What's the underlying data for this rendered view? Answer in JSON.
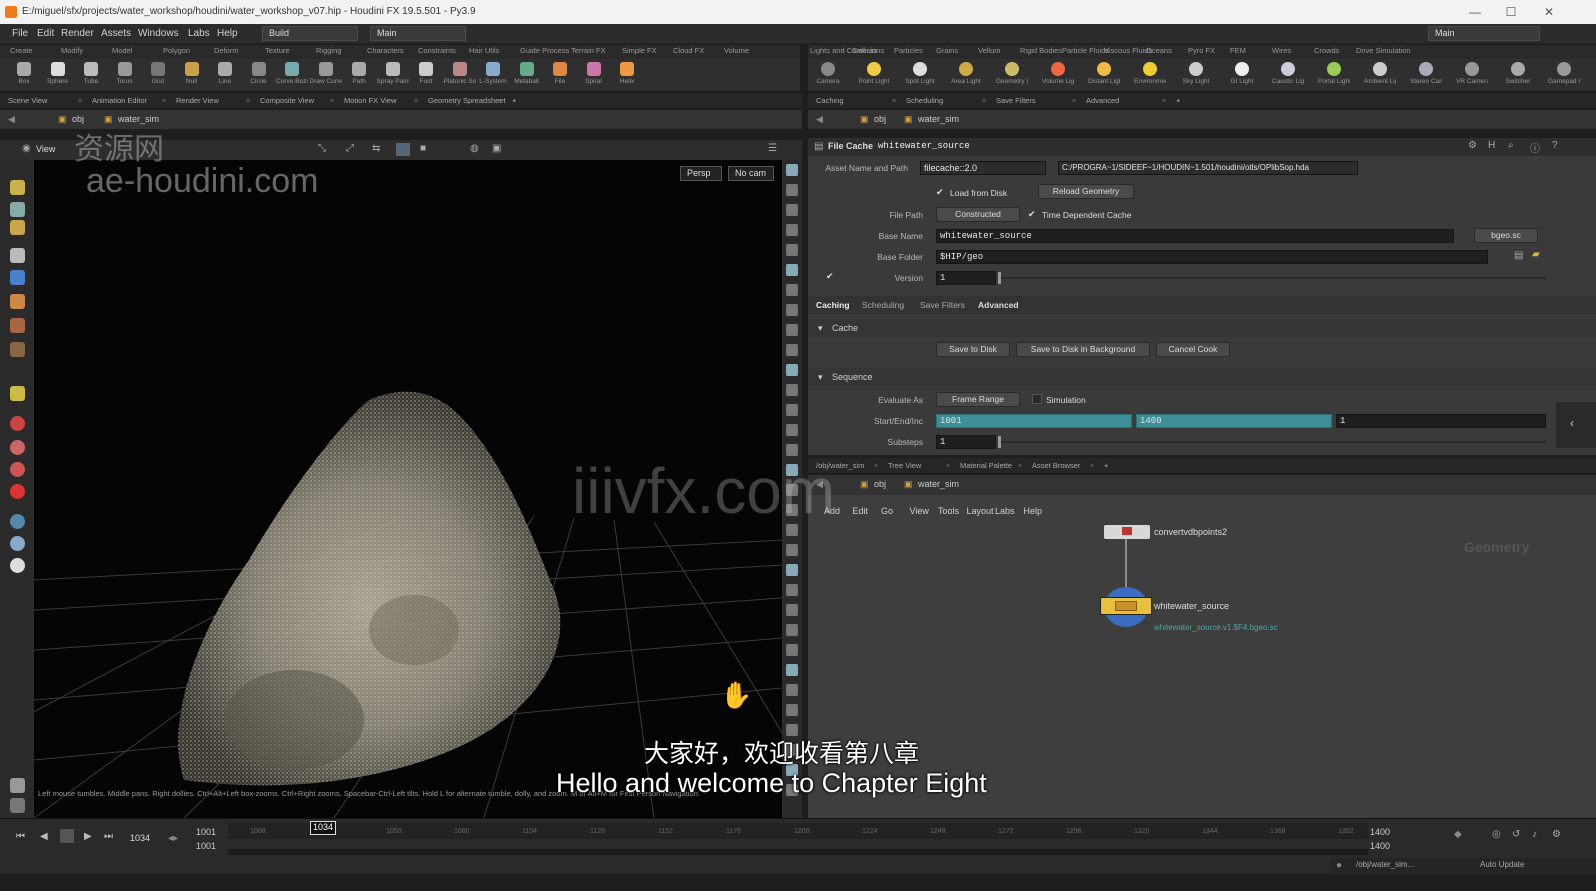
{
  "window": {
    "title": "E:/miguel/sfx/projects/water_workshop/houdini/water_workshop_v07.hip - Houdini FX 19.5.501 - Py3.9",
    "minimize": "—",
    "maximize": "☐",
    "close": "✕"
  },
  "menubar": {
    "items": [
      "File",
      "Edit",
      "Render",
      "Assets",
      "Windows",
      "Labs",
      "Help"
    ],
    "desktop": "Build",
    "runtime": "Main",
    "right_desktop": "Main"
  },
  "shelf_left": {
    "tabs": [
      "Create",
      "Modify",
      "Model",
      "Polygon",
      "Deform",
      "Texture",
      "Rigging",
      "Characters",
      "Constraints",
      "Hair Utils",
      "Guide Process",
      "Terrain FX",
      "Simple FX",
      "Cloud FX",
      "Volume"
    ],
    "tools": [
      "Box",
      "Sphere",
      "Tube",
      "Torus",
      "Grid",
      "Null",
      "Line",
      "Circle",
      "Curve Bezier",
      "Draw Curve",
      "Path",
      "Spray Paint",
      "Font",
      "Platonic Solids",
      "L-System",
      "Metaball",
      "File",
      "Spiral",
      "Helix"
    ]
  },
  "shelf_right": {
    "tabs": [
      "Lights and Cameras",
      "Collisions",
      "Particles",
      "Grains",
      "Vellum",
      "Rigid Bodies",
      "Particle Fluids",
      "Viscous Fluids",
      "Oceans",
      "Pyro FX",
      "FEM",
      "Wires",
      "Crowds",
      "Drive Simulation"
    ],
    "tools": [
      "Camera",
      "Point Light",
      "Spot Light",
      "Area Light",
      "Geometry Light",
      "Volume Light",
      "Distant Light",
      "Environment Light",
      "Sky Light",
      "GI Light",
      "Caustic Light",
      "Portal Light",
      "Ambient Light",
      "Stereo Camera",
      "VR Camera",
      "Switcher",
      "Gamepad Camera"
    ]
  },
  "left_pane": {
    "tabs": [
      "Scene View",
      "Animation Editor",
      "Render View",
      "Composite View",
      "Motion FX View",
      "Geometry Spreadsheet"
    ],
    "path": [
      "obj",
      "water_sim"
    ],
    "view_label": "View",
    "persp": "Persp",
    "camera": "No cam",
    "hint": "Left mouse tumbles. Middle pans. Right dollies. Ctrl+Alt+Left box-zooms. Ctrl+Right zooms. Spacebar-Ctrl-Left tilts. Hold L for alternate tumble, dolly, and zoom.    M or Alt+M for First Person Navigation."
  },
  "right_top_pane": {
    "tabs": [
      "Caching",
      "Scheduling",
      "Save Filters",
      "Advanced"
    ],
    "path": [
      "obj",
      "water_sim"
    ],
    "node_type": "File Cache",
    "node_name": "whitewater_source",
    "asset_label": "Asset Name and Path",
    "asset_name": "filecache::2.0",
    "asset_path": "C:/PROGRA~1/SIDEEF~1/HOUDIN~1.501/houdini/otls/OPlibSop.hda",
    "load_from_disk": "Load from Disk",
    "reload_geometry": "Reload Geometry",
    "file_path_label": "File Path",
    "file_path_mode": "Constructed",
    "time_dependent": "Time Dependent Cache",
    "base_name_label": "Base Name",
    "base_name": "whitewater_source",
    "format": "bgeo.sc",
    "base_folder_label": "Base Folder",
    "base_folder": "$HIP/geo",
    "version_label": "Version",
    "version": "1",
    "cache_section": "Cache",
    "save_to_disk": "Save to Disk",
    "save_bg": "Save to Disk in Background",
    "cancel_cook": "Cancel Cook",
    "sequence_section": "Sequence",
    "evaluate_label": "Evaluate As",
    "evaluate_value": "Frame Range",
    "simulation": "Simulation",
    "start_end_label": "Start/End/Inc",
    "start": "1001",
    "end": "1400",
    "inc": "1",
    "substeps_label": "Substeps",
    "substeps": "1"
  },
  "right_bottom_pane": {
    "tabs": [
      "/obj/water_sim",
      "Tree View",
      "Material Palette",
      "Asset Browser"
    ],
    "path": [
      "obj",
      "water_sim"
    ],
    "menu": [
      "Add",
      "Edit",
      "Go",
      "View",
      "Tools",
      "Layout",
      "Labs",
      "Help"
    ],
    "context": "Geometry",
    "nodes": [
      {
        "name": "convertvdbpoints2"
      },
      {
        "name": "whitewater_source",
        "sub": "whitewater_source.v1.$F4.bgeo.sc"
      }
    ]
  },
  "timeline": {
    "current_frame": "1034",
    "start": "1001",
    "start2": "1001",
    "end": "1400",
    "end2": "1400",
    "ticks": [
      "1008",
      "1034",
      "1050",
      "1080",
      "1104",
      "1128",
      "1152",
      "1176",
      "1200",
      "1224",
      "1248",
      "1272",
      "1296",
      "1320",
      "1344",
      "1368",
      "1392"
    ],
    "status_path": "/obj/water_sim...",
    "auto_update": "Auto Update"
  },
  "watermarks": {
    "cn": "资源网",
    "site": "ae-houdini.com",
    "center": "iiivfx.com"
  },
  "subtitles": {
    "cn": "大家好，欢迎收看第八章",
    "en": "Hello and welcome to Chapter Eight"
  },
  "colors": {
    "accent_teal": "#3b8f95",
    "node_yellow": "#e7c13c",
    "node_ring": "#3a6cc0"
  }
}
